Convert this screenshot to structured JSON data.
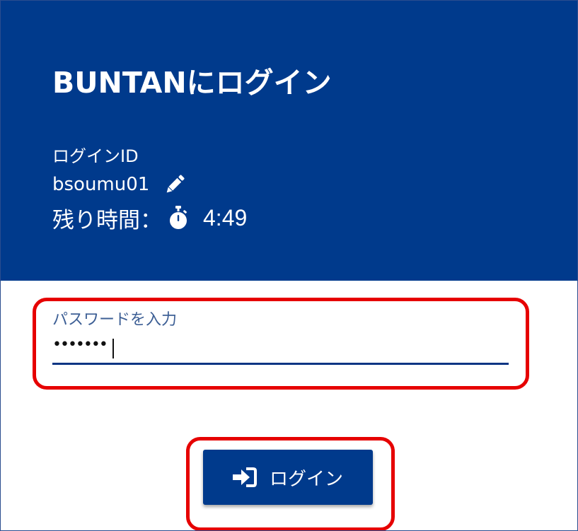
{
  "header": {
    "title": "BUNTANにログイン",
    "login_id_label": "ログインID",
    "login_id_value": "bsoumu01",
    "edit_icon": "pencil-icon",
    "remaining_time_label": "残り時間：",
    "timer_icon": "stopwatch-icon",
    "remaining_time_value": "4:49",
    "background_color": "#003a8c"
  },
  "password": {
    "label": "パスワードを入力",
    "masked_value": "•••••••",
    "underline_color": "#0b3583"
  },
  "login_button": {
    "icon": "sign-in-icon",
    "label": "ログイン"
  },
  "annotations": {
    "highlight_color": "#e60000"
  }
}
